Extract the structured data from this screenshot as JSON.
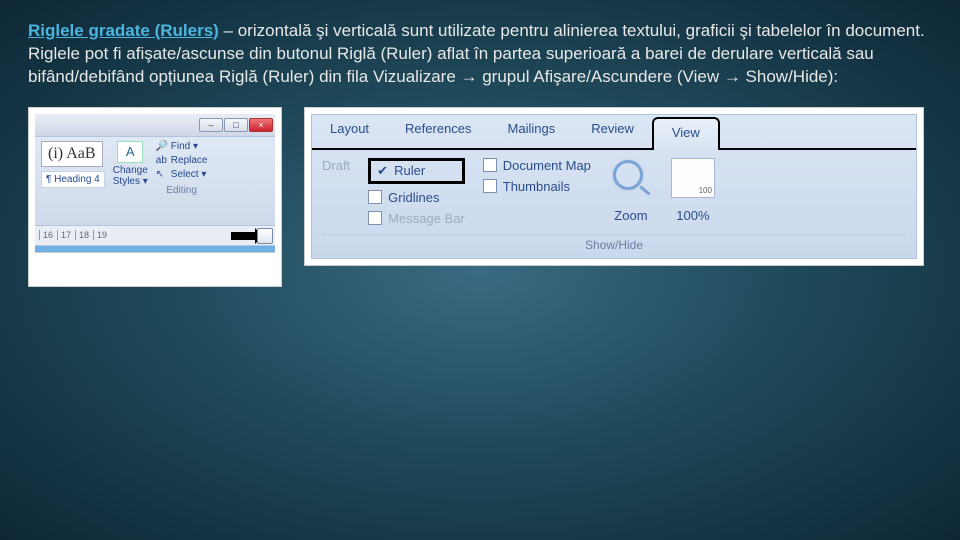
{
  "description": {
    "bold_lead": "Riglele gradate (Rulers)",
    "rest": " – orizontală şi verticală sunt utilizate pentru alinierea textului, graficii şi tabelelor în document. Riglele pot fi afişate/ascunse din butonul Riglă (Ruler) aflat în partea superioară a barei de derulare verticală sau bifând/debifând opțiunea Riglă (Ruler) din fila Vizualizare → grupul Afişare/Ascundere (View → Show/Hide):"
  },
  "fig1": {
    "sample_text": "(i) AaB",
    "heading4": "¶ Heading 4",
    "change_styles_line1": "Change",
    "change_styles_line2": "Styles ▾",
    "find": "Find  ▾",
    "replace": "Replace",
    "select": "Select ▾",
    "editing_group": "Editing",
    "ruler_ticks": [
      "16",
      "17",
      "18",
      "19"
    ]
  },
  "fig2": {
    "tabs": {
      "layout": "Layout",
      "references": "References",
      "mailings": "Mailings",
      "review": "Review",
      "view": "View"
    },
    "draft": "Draft",
    "ruler": "Ruler",
    "gridlines": "Gridlines",
    "message_bar": "Message Bar",
    "document_map": "Document Map",
    "thumbnails": "Thumbnails",
    "show_hide": "Show/Hide",
    "zoom": "Zoom",
    "hundred": "100%",
    "pct100_badge": "100"
  }
}
